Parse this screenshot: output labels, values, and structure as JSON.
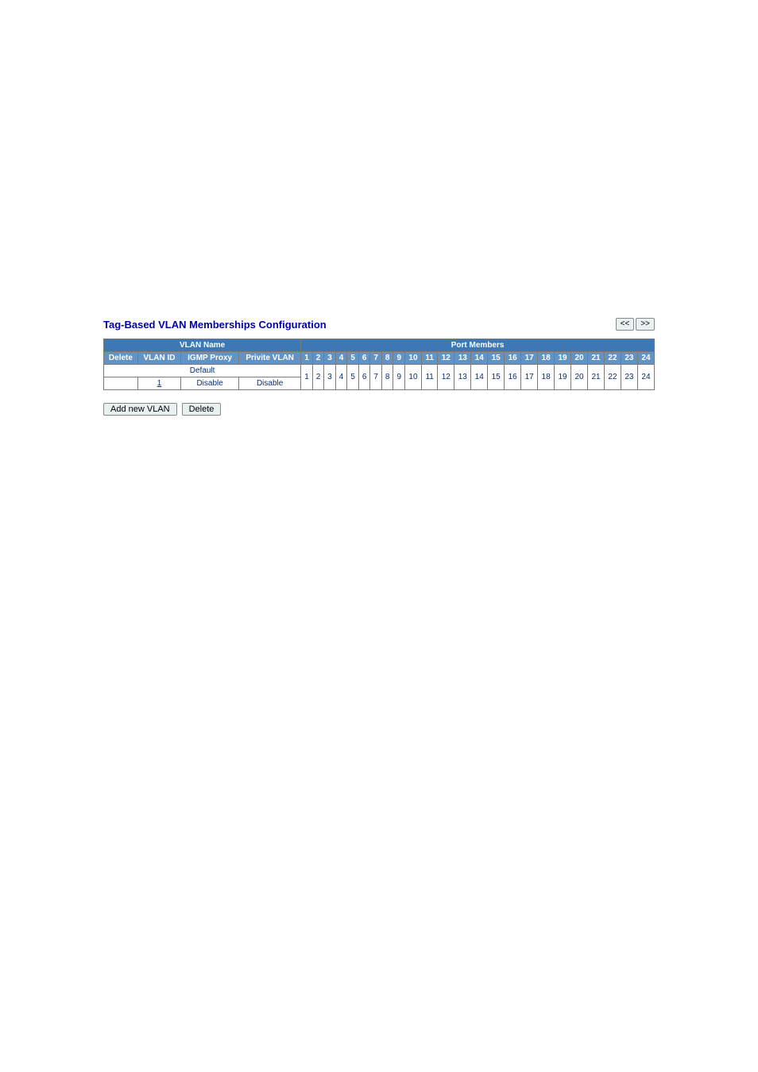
{
  "title": "Tag-Based VLAN Memberships Configuration",
  "nav": {
    "prev": "<<",
    "next": ">>"
  },
  "headers": {
    "vlan_name_group": "VLAN Name",
    "port_members_group": "Port Members",
    "delete": "Delete",
    "vlan_id": "VLAN ID",
    "igmp_proxy": "IGMP Proxy",
    "private_vlan": "Privite VLAN"
  },
  "ports": [
    "1",
    "2",
    "3",
    "4",
    "5",
    "6",
    "7",
    "8",
    "9",
    "10",
    "11",
    "12",
    "13",
    "14",
    "15",
    "16",
    "17",
    "18",
    "19",
    "20",
    "21",
    "22",
    "23",
    "24"
  ],
  "data_ports": [
    "1",
    "2",
    "3",
    "4",
    "5",
    "6",
    "7",
    "8",
    "9",
    "10",
    "11",
    "12",
    "13",
    "14",
    "15",
    "16",
    "17",
    "18",
    "19",
    "20",
    "21",
    "22",
    "23",
    "24"
  ],
  "row": {
    "name": "Default",
    "delete": "",
    "vlan_id": "1",
    "igmp_proxy": "Disable",
    "private_vlan": "Disable"
  },
  "buttons": {
    "add": "Add new VLAN",
    "delete": "Delete"
  }
}
